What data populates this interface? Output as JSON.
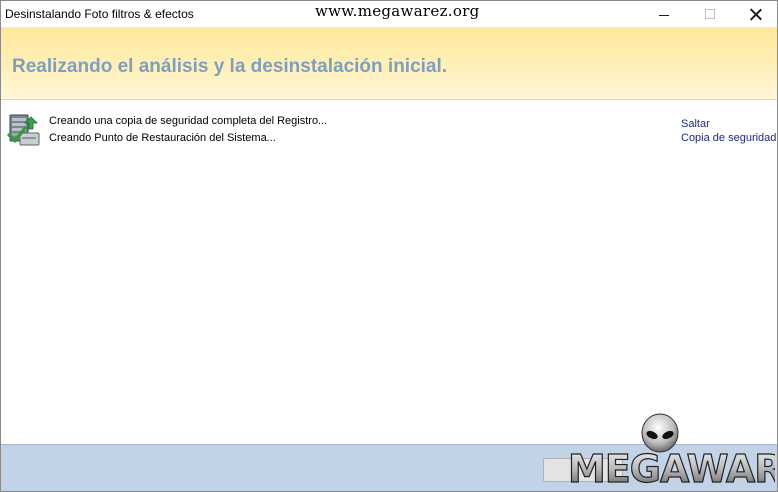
{
  "window": {
    "title": "Desinstalando Foto filtros & efectos",
    "watermark_url": "www.megawarez.org"
  },
  "banner": {
    "title": "Realizando el análisis y la desinstalación inicial."
  },
  "steps": [
    {
      "label": "Creando una copia de seguridad completa del Registro..."
    },
    {
      "label": "Creando Punto de Restauración del Sistema..."
    }
  ],
  "links": {
    "skip": "Saltar",
    "backup": "Copia de seguridad"
  },
  "logo": {
    "text": "MEGAWAREZ"
  },
  "icons": {
    "status": "registry-backup-icon",
    "minimize": "minimize-icon",
    "maximize": "maximize-icon",
    "close": "close-icon"
  },
  "colors": {
    "banner": "#ffe89a",
    "banner_title": "#7f9ec0",
    "footer": "#c2d3e8",
    "link": "#1a2a8c"
  }
}
